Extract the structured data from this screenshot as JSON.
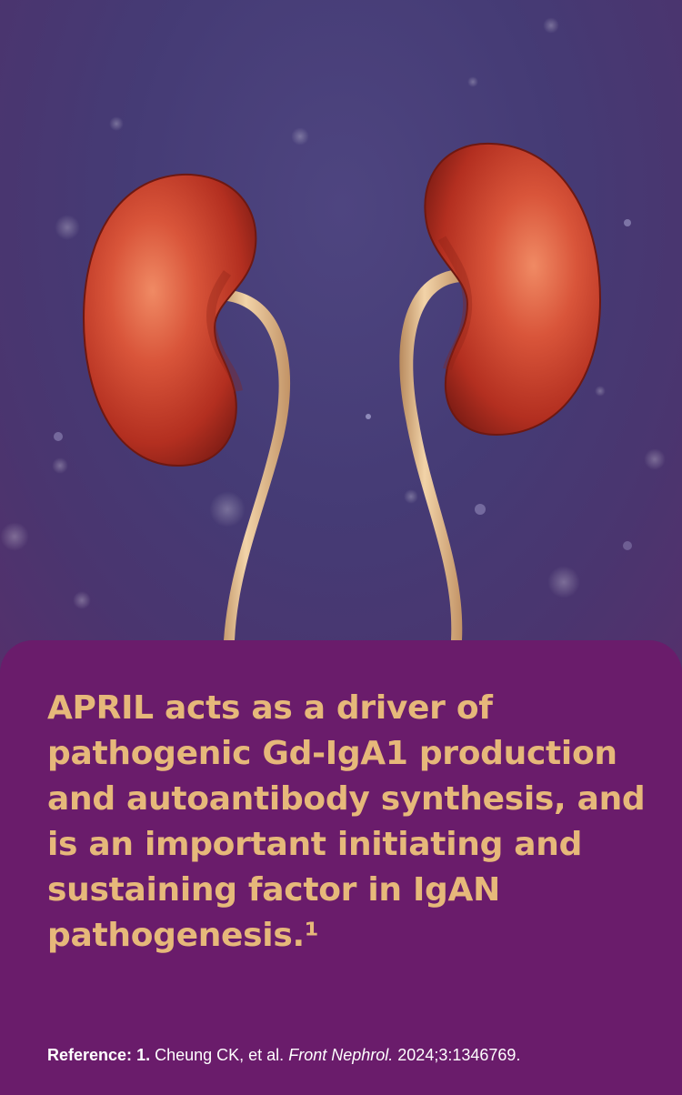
{
  "illustration": {
    "subject": "kidneys-with-ureters",
    "colors": {
      "background": "#4a3c72",
      "kidney": "#c5402b",
      "ureter": "#e0b98a"
    }
  },
  "card": {
    "background": "#6a1c6b",
    "text_color": "#e6b87a",
    "headline": "APRIL acts as a driver of pathogenic Gd-IgA1 production and autoantibody synthesis, and is an important initiating and sustaining factor in IgAN pathogenesis.¹"
  },
  "reference": {
    "label": "Reference:",
    "number": "1.",
    "authors": "Cheung CK, et al.",
    "journal": "Front Nephrol.",
    "citation": "2024;3:1346769."
  }
}
